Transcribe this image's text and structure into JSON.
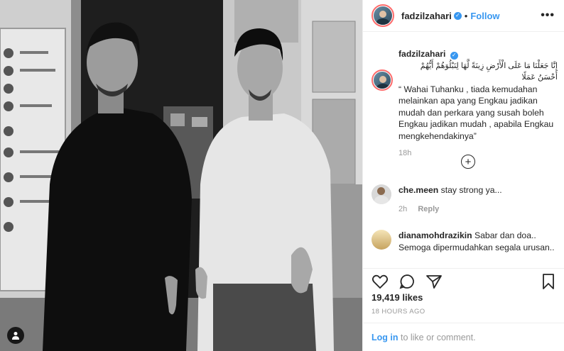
{
  "header": {
    "username": "fadzilzahari",
    "dot": "•",
    "follow_label": "Follow",
    "more_label": "•••"
  },
  "caption": {
    "username": "fadzilzahari",
    "arabic": "إِنَّا جَعَلْنَا مَا عَلَى الْأَرْضِ زِينَةً لَّهَا لِنَبْلُوَهُمْ أَيُّهُمْ أَحْسَنُ عَمَلًا",
    "text": "“ Wahai Tuhanku , tiada kemudahan melainkan apa yang Engkau jadikan mudah dan perkara yang susah boleh Engkau jadikan mudah , apabila Engkau mengkehendakinya”",
    "time": "18h"
  },
  "load_more": {
    "label": "+"
  },
  "comments": [
    {
      "username": "che.meen",
      "text": "stay strong ya...",
      "time": "2h",
      "reply_label": "Reply"
    },
    {
      "username": "dianamohdrazikin",
      "text": "Sabar dan doa.. Semoga dipermudahkan segala urusan.. InshaAllah ada hikmah..Allah"
    }
  ],
  "likes": {
    "count": "19,419",
    "label": "likes"
  },
  "post_time": "18 HOURS AGO",
  "login": {
    "link": "Log in",
    "rest": "to like or comment."
  },
  "icons": {
    "heart": "heart-icon",
    "comment": "comment-icon",
    "share": "share-icon",
    "save": "bookmark-icon",
    "tag": "user-tag-icon",
    "verified": "verified-icon"
  },
  "colors": {
    "accent": "#3897f0",
    "muted": "#999999",
    "border": "#efefef",
    "ring": "#ff6b6b"
  }
}
